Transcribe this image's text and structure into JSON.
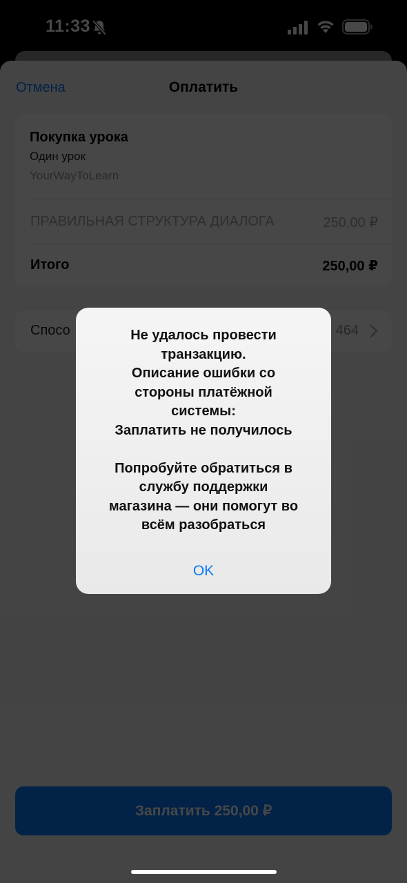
{
  "status_bar": {
    "time": "11:33",
    "icons": [
      "bell-slash-icon",
      "signal-icon",
      "wifi-icon",
      "battery-icon"
    ]
  },
  "header": {
    "cancel_label": "Отмена",
    "title": "Оплатить"
  },
  "summary": {
    "product_title": "Покупка урока",
    "product_subtitle": "Один урок",
    "seller": "YourWayToLearn",
    "item_name": "ПРАВИЛЬНАЯ СТРУКТУРА ДИАЛОГА",
    "item_price": "250,00 ₽",
    "total_label": "Итого",
    "total_value": "250,00 ₽"
  },
  "payment_method": {
    "label": "Спосо",
    "value": "464"
  },
  "pay_button": {
    "label": "Заплатить 250,00 ₽"
  },
  "alert": {
    "message": "Не удалось провести\nтранзакцию.\nОписание ошибки со\nстороны платёжной\nсистемы:\nЗаплатить не получилось\n\nПопробуйте обратиться в\nслужбу поддержки\nмагазина — они помогут во\nвсём разобраться",
    "ok_label": "OK"
  },
  "colors": {
    "accent": "#0a7aff",
    "sheet_background": "#f2f2f6",
    "card_background": "#ffffff",
    "overlay": "rgba(0,0,0,0.72)"
  }
}
